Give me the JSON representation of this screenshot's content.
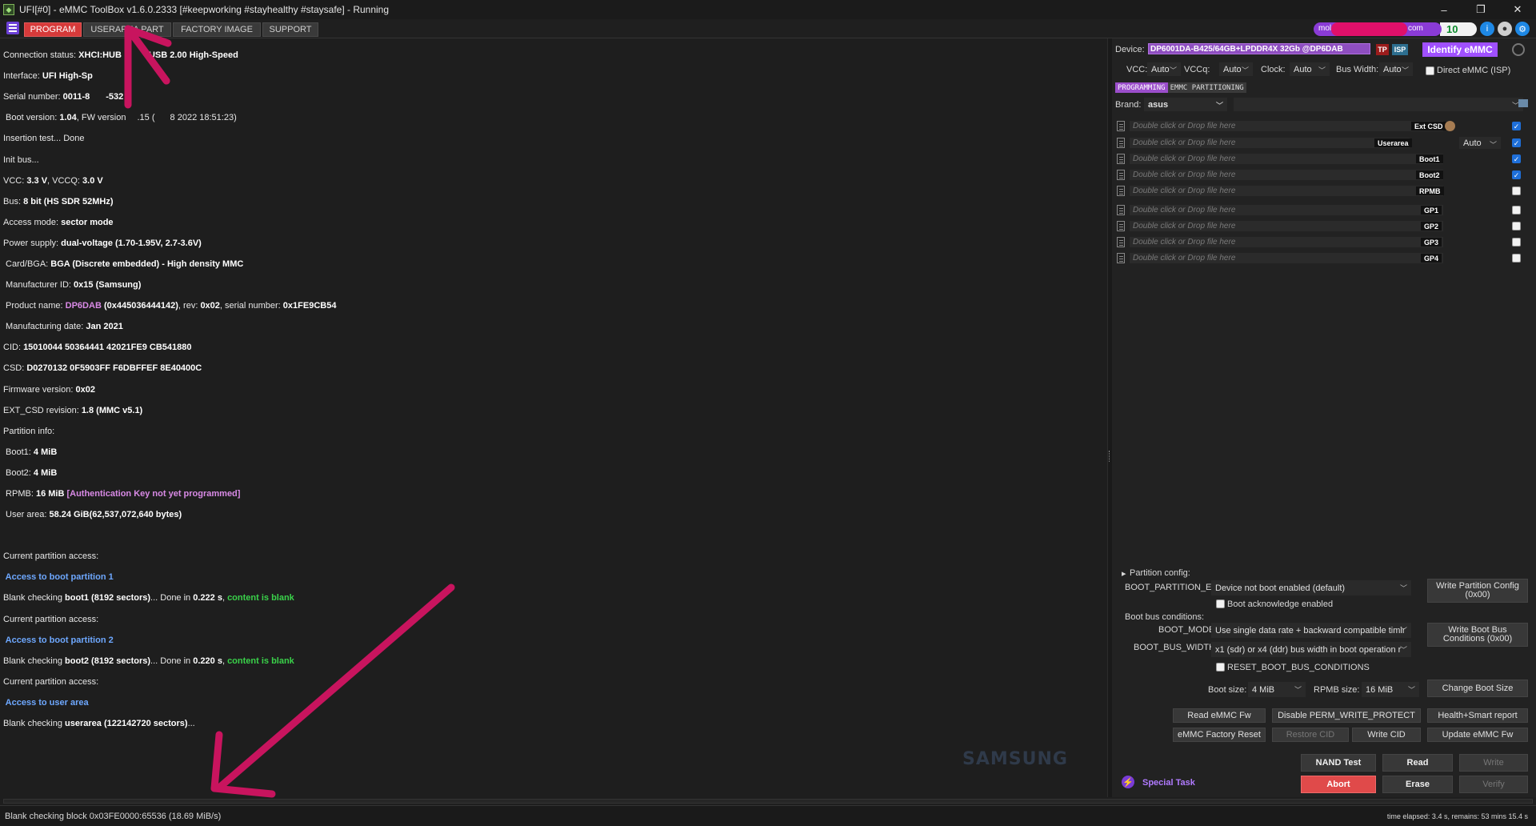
{
  "window": {
    "title": "UFI[#0] - eMMC ToolBox v1.6.0.2333 [#keepworking #stayhealthy #staysafe] - Running",
    "minimize": "–",
    "maximize": "❐",
    "close": "✕"
  },
  "tabs": [
    "PROGRAM",
    "USERAREA PART",
    "FACTORY IMAGE",
    "SUPPORT"
  ],
  "account": {
    "left": "mol",
    "right": "com",
    "credits": "10"
  },
  "log": {
    "l01_a": "Connection status: ",
    "l01_b": "XHCI:HUB",
    "l01_c": "USB 2.00 High-Speed",
    "l02_a": "Interface: ",
    "l02_b": "UFI High-Sp",
    "l03_a": "Serial number: ",
    "l03_b": "0011-8",
    "l03_c": "-532",
    "l04_a": " Boot version: ",
    "l04_b": "1.04",
    "l04_c": ", FW version",
    "l04_d": ".15 (",
    "l04_e": " 8 2022 18:51:23)",
    "l05": "Insertion test... Done",
    "l06": "Init bus...",
    "l07_a": "VCC: ",
    "l07_b": "3.3 V",
    "l07_c": ", VCCQ: ",
    "l07_d": "3.0 V",
    "l08_a": "Bus: ",
    "l08_b": "8 bit (HS SDR 52MHz)",
    "l09_a": "Access mode: ",
    "l09_b": "sector mode",
    "l10_a": "Power supply: ",
    "l10_b": "dual-voltage (1.70-1.95V, 2.7-3.6V)",
    "l11_a": " Card/BGA: ",
    "l11_b": "BGA (Discrete embedded) - High density MMC",
    "l12_a": " Manufacturer ID: ",
    "l12_b": "0x15 (Samsung)",
    "l13_a": " Product name: ",
    "l13_b": "DP6DAB",
    "l13_c": " (0x445036444142)",
    "l13_d": ", rev: ",
    "l13_e": "0x02",
    "l13_f": ", serial number: ",
    "l13_g": "0x1FE9CB54",
    "l14_a": " Manufacturing date: ",
    "l14_b": "Jan 2021",
    "l15_a": "CID: ",
    "l15_b": "15010044 50364441 42021FE9 CB541880",
    "l16_a": "CSD: ",
    "l16_b": "D0270132 0F5903FF F6DBFFEF 8E40400C",
    "l17_a": "Firmware version: ",
    "l17_b": "0x02",
    "l18_a": "EXT_CSD revision: ",
    "l18_b": "1.8 (MMC v5.1)",
    "l19": "Partition info:",
    "l20_a": " Boot1: ",
    "l20_b": "4 MiB",
    "l21_a": " Boot2: ",
    "l21_b": "4 MiB",
    "l22_a": " RPMB: ",
    "l22_b": "16 MiB",
    "l22_c": " [Authentication Key not yet programmed]",
    "l23_a": " User area: ",
    "l23_b": "58.24 GiB(62,537,072,640 bytes)",
    "l25": "Current partition access:",
    "l26": " Access to boot partition 1",
    "l27_a": "Blank checking ",
    "l27_b": "boot1 (8192 sectors)",
    "l27_c": "... Done in ",
    "l27_d": "0.222 s",
    "l27_e": ", ",
    "l27_f": "content is blank",
    "l28": "Current partition access:",
    "l29": " Access to boot partition 2",
    "l30_a": "Blank checking ",
    "l30_b": "boot2 (8192 sectors)",
    "l30_c": "... Done in ",
    "l30_d": "0.220 s",
    "l30_e": ", ",
    "l30_f": "content is blank",
    "l31": "Current partition access:",
    "l32": " Access to user area",
    "l33_a": "Blank checking ",
    "l33_b": "userarea (122142720 sectors)",
    "l33_c": "..."
  },
  "right": {
    "device_label": "Device:",
    "device_value": "DP6001DA-B425/64GB+LPDDR4X 32Gb @DP6DAB",
    "tp": "TP",
    "isp": "ISP",
    "identify": "Identify eMMC",
    "vcc_label": "VCC:",
    "vcc": "Auto",
    "vccq_label": "VCCq:",
    "vccq": "Auto",
    "clock_label": "Clock:",
    "clock": "Auto",
    "buswidth_label": "Bus Width:",
    "buswidth": "Auto",
    "direct_emmc": "Direct eMMC (ISP)",
    "subtabs": [
      "PROGRAMMING",
      "EMMC PARTITIONING"
    ],
    "brand_label": "Brand:",
    "brand": "asus",
    "file_placeholder": "Double click or Drop file here",
    "files": [
      {
        "tag": "Ext CSD"
      },
      {
        "tag": "Userarea",
        "mode": "Auto"
      },
      {
        "tag": "Boot1"
      },
      {
        "tag": "Boot2"
      },
      {
        "tag": "RPMB"
      },
      {
        "tag": "GP1"
      },
      {
        "tag": "GP2"
      },
      {
        "tag": "GP3"
      },
      {
        "tag": "GP4"
      }
    ],
    "partition_config": "Partition config:",
    "boot_partition_en_label": "BOOT_PARTITION_EN",
    "boot_partition_en": "Device not boot enabled (default)",
    "boot_ack": "Boot acknowledge enabled",
    "write_partition_config": "Write Partition Config (0x00)",
    "boot_bus_conditions": "Boot bus conditions:",
    "boot_mode_label": "BOOT_MODE",
    "boot_mode": "Use single data rate + backward compatible timir",
    "boot_bus_width_label": "BOOT_BUS_WIDTH",
    "boot_bus_width": "x1 (sdr) or x4 (ddr) bus width in boot operation r",
    "write_boot_bus": "Write Boot Bus Conditions (0x00)",
    "reset_boot_bus": "RESET_BOOT_BUS_CONDITIONS",
    "boot_size_label": "Boot size:",
    "boot_size": "4 MiB",
    "rpmb_size_label": "RPMB size:",
    "rpmb_size": "16 MiB",
    "change_boot_size": "Change Boot Size",
    "read_emmc_fw": "Read eMMC Fw",
    "disable_perm_wp": "Disable PERM_WRITE_PROTECT",
    "health_report": "Health+Smart report",
    "factory_reset": "eMMC Factory Reset",
    "restore_cid": "Restore CID",
    "write_cid": "Write CID",
    "update_fw": "Update eMMC Fw",
    "special_task": "Special Task",
    "nand_test": "NAND Test",
    "read": "Read",
    "write": "Write",
    "abort": "Abort",
    "erase": "Erase",
    "verify": "Verify"
  },
  "watermark": "SAMSUNG",
  "status": {
    "left": "Blank checking block 0x03FE0000:65536 (18.69 MiB/s)",
    "right": "time elapsed: 3.4 s, remains: 53 mins 15.4 s"
  },
  "colors": {
    "accent_red": "#d63a3a",
    "accent_purple": "#a050ff",
    "annotation_arrow": "#c8145e"
  }
}
